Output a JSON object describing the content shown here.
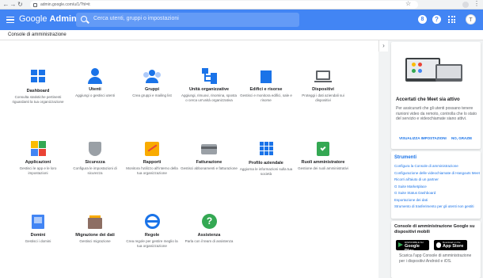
{
  "browser": {
    "url": "admin.google.com/u/1/?hl=it"
  },
  "header": {
    "logo_google": "Google",
    "logo_admin": "Admin",
    "search_placeholder": "Cerca utenti, gruppi o impostazioni",
    "badge_label": "8",
    "help_label": "?",
    "avatar_initial": "T"
  },
  "breadcrumb": "Console di amministrazione",
  "tiles": [
    {
      "title": "Dashboard",
      "desc": "Consulta statistiche pertinenti riguardanti la tua organizzazione",
      "icon": "dashboard-icon"
    },
    {
      "title": "Utenti",
      "desc": "Aggiungi o gestisci utenti",
      "icon": "user-icon"
    },
    {
      "title": "Gruppi",
      "desc": "Crea gruppi e mailing list",
      "icon": "group-icon"
    },
    {
      "title": "Unità organizzative",
      "desc": "Aggiungi, rimuovi, rinomina, sposta o cerca un'unità organizzativa",
      "icon": "org-units-icon"
    },
    {
      "title": "Edifici e risorse",
      "desc": "Gestisci e monitora edifici, sale e risorse",
      "icon": "building-icon"
    },
    {
      "title": "Dispositivi",
      "desc": "Proteggi i dati aziendali sui dispositivi",
      "icon": "devices-icon"
    },
    {
      "title": "Applicazioni",
      "desc": "Gestisci le app e le loro impostazioni",
      "icon": "apps-icon"
    },
    {
      "title": "Sicurezza",
      "desc": "Configura le impostazioni di sicurezza",
      "icon": "shield-icon"
    },
    {
      "title": "Rapporti",
      "desc": "Monitora l'utilizzo all'interno della tua organizzazione",
      "icon": "reports-icon"
    },
    {
      "title": "Fatturazione",
      "desc": "Gestisci abbonamenti e fatturazione",
      "icon": "billing-card-icon"
    },
    {
      "title": "Profilo aziendale",
      "desc": "Aggiorna le informazioni sulla tua società",
      "icon": "company-profile-icon"
    },
    {
      "title": "Ruoli amministratore",
      "desc": "Gestione dei ruoli amministrativi",
      "icon": "admin-badge-icon"
    },
    {
      "title": "Domini",
      "desc": "Gestisci i domini",
      "icon": "domain-icon"
    },
    {
      "title": "Migrazione dei dati",
      "desc": "Gestisci migrazione",
      "icon": "data-migration-icon"
    },
    {
      "title": "Regole",
      "desc": "Crea regole per gestire meglio la tua organizzazione",
      "icon": "rules-wheel-icon"
    },
    {
      "title": "Assistenza",
      "desc": "Parla con il team di assistenza",
      "icon": "support-help-icon"
    }
  ],
  "meet_card": {
    "title": "Accertati che Meet sia attivo",
    "body": "Per assicurarti che gli utenti possano tenere riunioni video da remoto, controlla che lo stato del servizio e videochiamate siano attivi.",
    "link_settings": "VISUALIZZA IMPOSTAZIONI",
    "link_dismiss": "NO, GRAZIE"
  },
  "tools_card": {
    "title": "Strumenti",
    "links": [
      "Configura la Console di amministrazione",
      "Configurazione delle videochiamate di Hangouts Meet",
      "Ricorri all'aiuto di un partner",
      "G Suite Marketplace",
      "G Suite Status Dashboard",
      "Esportazione dei dati",
      "Strumento di trasferimento per gli utenti non gestiti"
    ]
  },
  "mobile_card": {
    "title": "Console di amministrazione Google su dispositivi mobili",
    "play_small": "DISPONIBILE SU",
    "play_big": "Google Play",
    "apple_small": "Download on the",
    "apple_big": "App Store",
    "desc": "Scarica l'app Console di amministrazione per i dispositivi Android e iOS."
  },
  "colors": {
    "header_blue": "#4285f4",
    "link_blue": "#1a73e8"
  }
}
